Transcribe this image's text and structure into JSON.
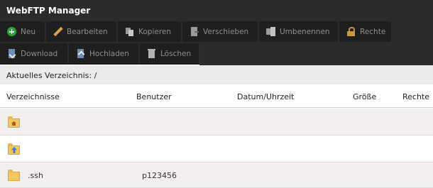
{
  "app": {
    "title": "WebFTP Manager"
  },
  "toolbar": {
    "row1": [
      {
        "label": "Neu",
        "icon": "plus-icon"
      },
      {
        "label": "Bearbeiten",
        "icon": "pencil-icon"
      },
      {
        "label": "Kopieren",
        "icon": "copy-icon"
      },
      {
        "label": "Verschieben",
        "icon": "move-icon"
      },
      {
        "label": "Umbenennen",
        "icon": "rename-icon"
      },
      {
        "label": "Rechte",
        "icon": "lock-icon"
      }
    ],
    "row2": [
      {
        "label": "Download",
        "icon": "download-icon"
      },
      {
        "label": "Hochladen",
        "icon": "upload-icon"
      },
      {
        "label": "Löschen",
        "icon": "trash-icon"
      }
    ]
  },
  "path": {
    "label": "Aktuelles Verzeichnis: /"
  },
  "table": {
    "columns": [
      "Verzeichnisse",
      "Benutzer",
      "Datum/Uhrzeit",
      "Größe",
      "Rechte"
    ],
    "rows": [
      {
        "icon": "home-folder-icon",
        "name": "",
        "user": "",
        "date": "",
        "size": "",
        "rights": ""
      },
      {
        "icon": "parent-folder-icon",
        "name": "",
        "user": "",
        "date": "",
        "size": "",
        "rights": ""
      },
      {
        "icon": "folder-icon",
        "name": ".ssh",
        "user": "p123456",
        "date": "",
        "size": "",
        "rights": ""
      }
    ]
  },
  "colors": {
    "toolbar_bg": "#2b2b2b",
    "button_bg": "#1f1f1f",
    "row_alt": "#f4efef",
    "accent_green": "#2fa33a"
  }
}
